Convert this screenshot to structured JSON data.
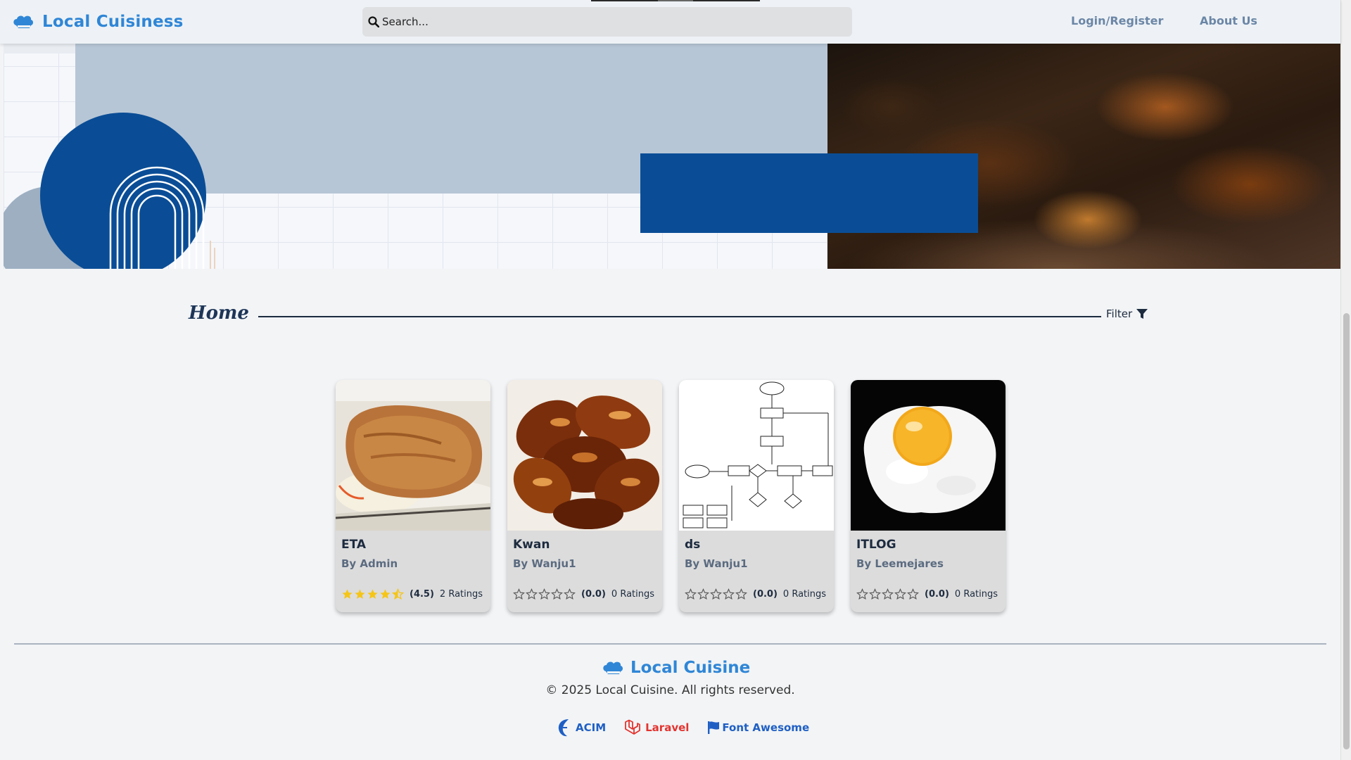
{
  "navbar": {
    "brand": "Local Cuisiness",
    "brand_icon": "chef-hat-icon",
    "search_placeholder": "Search...",
    "links": [
      "Login/Register",
      "About Us"
    ]
  },
  "section": {
    "title": "Home",
    "filter_label": "Filter"
  },
  "cards": [
    {
      "title": "ETA",
      "author": "By Admin",
      "score": "(4.5)",
      "ratings": "2 Ratings",
      "stars": 4.5
    },
    {
      "title": "Kwan",
      "author": "By Wanju1",
      "score": "(0.0)",
      "ratings": "0 Ratings",
      "stars": 0
    },
    {
      "title": "ds",
      "author": "By Wanju1",
      "score": "(0.0)",
      "ratings": "0 Ratings",
      "stars": 0
    },
    {
      "title": "ITLOG",
      "author": "By Leemejares",
      "score": "(0.0)",
      "ratings": "0 Ratings",
      "stars": 0
    }
  ],
  "footer": {
    "brand": "Local Cuisine",
    "copyright": "© 2025 Local Cuisine. All rights reserved.",
    "credits": [
      "ACIM",
      "Laravel",
      "Font Awesome"
    ]
  },
  "colors": {
    "brand": "#2f86d6",
    "accent_blue": "#0a4d96",
    "star_filled": "#f5c518",
    "nav_link": "#6b86a6"
  }
}
